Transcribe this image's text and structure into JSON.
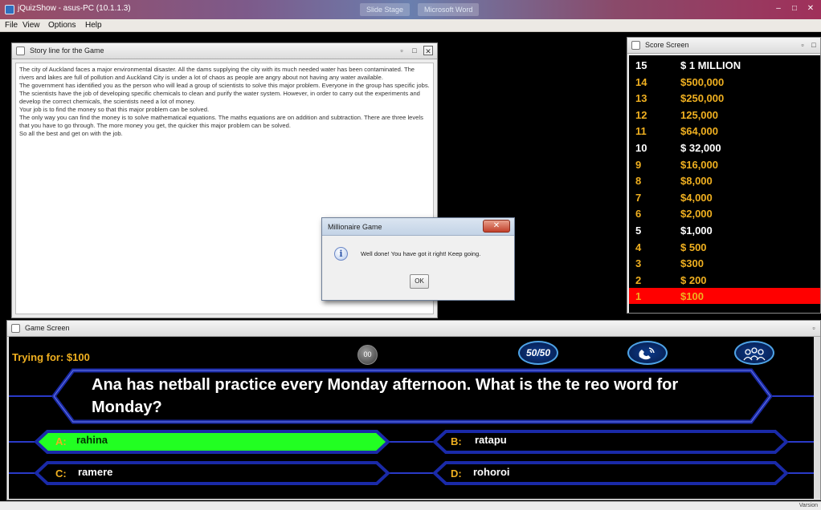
{
  "window": {
    "title": "jQuizShow - asus-PC (10.1.1.3)",
    "taskbar_items": [
      "Slide Stage",
      "Microsoft Word"
    ]
  },
  "menu": [
    "File",
    "View",
    "Options",
    "Help"
  ],
  "story": {
    "title": "Story line for the Game",
    "paragraphs": [
      "The city of Auckland faces a major environmental disaster. All the dams supplying the city with its much needed water has been contaminated. The rivers and lakes are full of pollution and Auckland City is under a lot of chaos as people are angry about not having any water available.",
      "The government has identified you as the person who will lead a group of scientists to solve this major problem. Everyone in the group has specific jobs. The scientists have the job of developing specific chemicals to clean and purify the water system. However, in order to carry out the experiments and develop the correct chemicals, the scientists need a lot of money.",
      "Your job is to find the money so that this major problem can be solved.",
      "The only way you can find the money is to solve mathematical equations. The maths equations are on addition and subtraction. There are three levels that you have to go through. The more money you get, the quicker this major problem can be solved.",
      "So all the best and get on with the job."
    ]
  },
  "score": {
    "title": "Score Screen",
    "levels": [
      {
        "num": "15",
        "amount": "$ 1 MILLION",
        "style": "white"
      },
      {
        "num": "14",
        "amount": "$500,000",
        "style": "gold"
      },
      {
        "num": "13",
        "amount": "$250,000",
        "style": "gold"
      },
      {
        "num": "12",
        "amount": "125,000",
        "style": "gold"
      },
      {
        "num": "11",
        "amount": "$64,000",
        "style": "gold"
      },
      {
        "num": "10",
        "amount": "$ 32,000",
        "style": "white"
      },
      {
        "num": "9",
        "amount": "$16,000",
        "style": "gold"
      },
      {
        "num": "8",
        "amount": "$8,000",
        "style": "gold"
      },
      {
        "num": "7",
        "amount": "$4,000",
        "style": "gold"
      },
      {
        "num": "6",
        "amount": "$2,000",
        "style": "gold"
      },
      {
        "num": "5",
        "amount": "$1,000",
        "style": "white"
      },
      {
        "num": "4",
        "amount": "$ 500",
        "style": "gold"
      },
      {
        "num": "3",
        "amount": "$300",
        "style": "gold"
      },
      {
        "num": "2",
        "amount": "$ 200",
        "style": "gold"
      },
      {
        "num": "1",
        "amount": "$100",
        "style": "current"
      }
    ]
  },
  "dialog": {
    "title": "Millionaire Game",
    "message": "Well done! You have got it right! Keep going.",
    "ok_label": "OK"
  },
  "game": {
    "title": "Game Screen",
    "trying_for": "Trying for: $100",
    "timer": "00",
    "lifelines": [
      {
        "name": "fifty-fifty",
        "label": "50/50"
      },
      {
        "name": "phone-a-friend",
        "label": ""
      },
      {
        "name": "ask-the-audience",
        "label": ""
      }
    ],
    "question": "Ana has netball practice every Monday afternoon. What is the te reo word for Monday?",
    "answers": {
      "a": {
        "letter": "A:",
        "text": "rahina"
      },
      "b": {
        "letter": "B:",
        "text": "ratapu"
      },
      "c": {
        "letter": "C:",
        "text": "ramere"
      },
      "d": {
        "letter": "D:",
        "text": "rohoroi"
      }
    },
    "selected_answer": "A",
    "colors": {
      "gold": "#f0b020",
      "selected": "#22ff22",
      "frame": "#1a2aa8",
      "current_level": "#ff0000"
    }
  },
  "status": {
    "text": "Varsion"
  }
}
